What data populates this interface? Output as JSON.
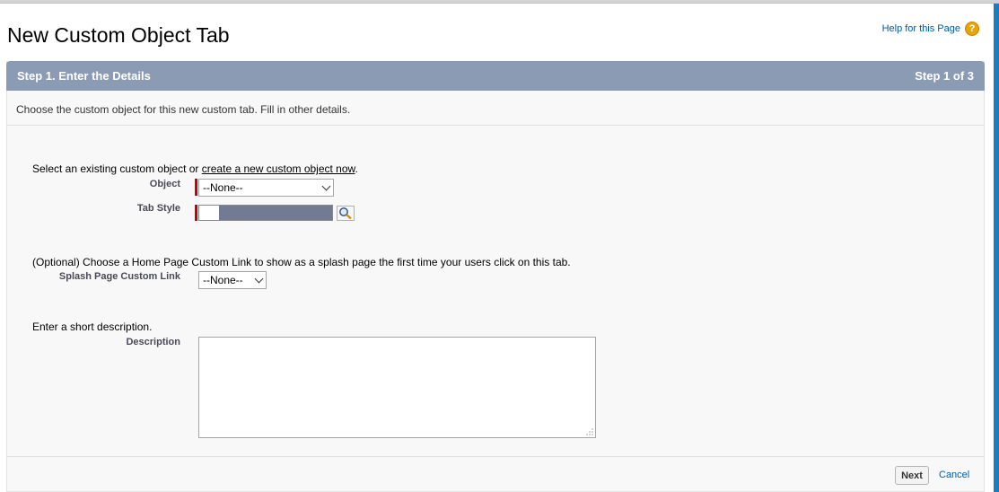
{
  "header": {
    "title": "New Custom Object Tab",
    "help_link": "Help for this Page",
    "help_icon": "?"
  },
  "step": {
    "title": "Step 1. Enter the Details",
    "counter": "Step 1 of 3"
  },
  "instruction": "Choose the custom object for this new custom tab. Fill in other details.",
  "object_section": {
    "prefix": "Select an existing custom object or ",
    "link": "create a new custom object now",
    "suffix": ".",
    "object_label": "Object",
    "object_value": "--None--",
    "tab_style_label": "Tab Style"
  },
  "splash_section": {
    "text": "(Optional) Choose a Home Page Custom Link to show as a splash page the first time your users click on this tab.",
    "label": "Splash Page Custom Link",
    "value": "--None--"
  },
  "description_section": {
    "text": "Enter a short description.",
    "label": "Description",
    "value": ""
  },
  "footer": {
    "next_label": "Next",
    "cancel_label": "Cancel"
  },
  "colors": {
    "step_bar": "#8c9bb4",
    "required": "#cc0000",
    "tab_swatch": "#737a94",
    "link": "#015ba7",
    "help_icon": "#e8a400"
  }
}
